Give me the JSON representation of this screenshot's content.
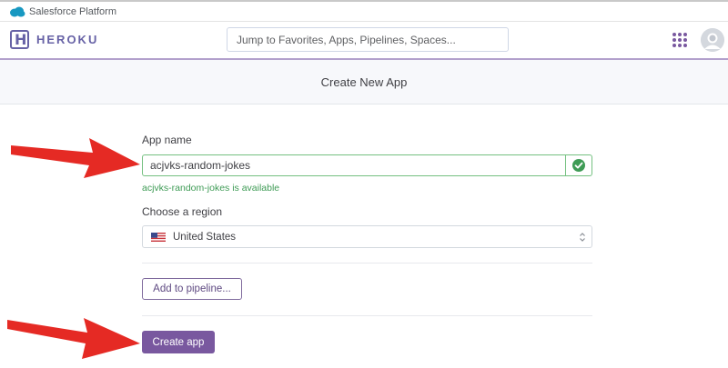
{
  "salesforce_bar": {
    "text": "Salesforce Platform",
    "icon": "cloud-icon"
  },
  "header": {
    "logo_letter": "H",
    "wordmark": "HEROKU",
    "search_placeholder": "Jump to Favorites, Apps, Pipelines, Spaces...",
    "apps_icon": "apps-grid-icon",
    "avatar_icon": "user-avatar-icon"
  },
  "page": {
    "title": "Create New App"
  },
  "form": {
    "app_name_label": "App name",
    "app_name_value": "acjvks-random-jokes",
    "availability_name": "acjvks-random-jokes",
    "availability_suffix": " is available",
    "region_label": "Choose a region",
    "region_value": "United States",
    "region_flag": "us-flag-icon",
    "pipeline_button": "Add to pipeline...",
    "create_button": "Create app"
  },
  "colors": {
    "brand": "#79589f",
    "success": "#3e9b55",
    "annotation_arrow": "#e52a24"
  }
}
